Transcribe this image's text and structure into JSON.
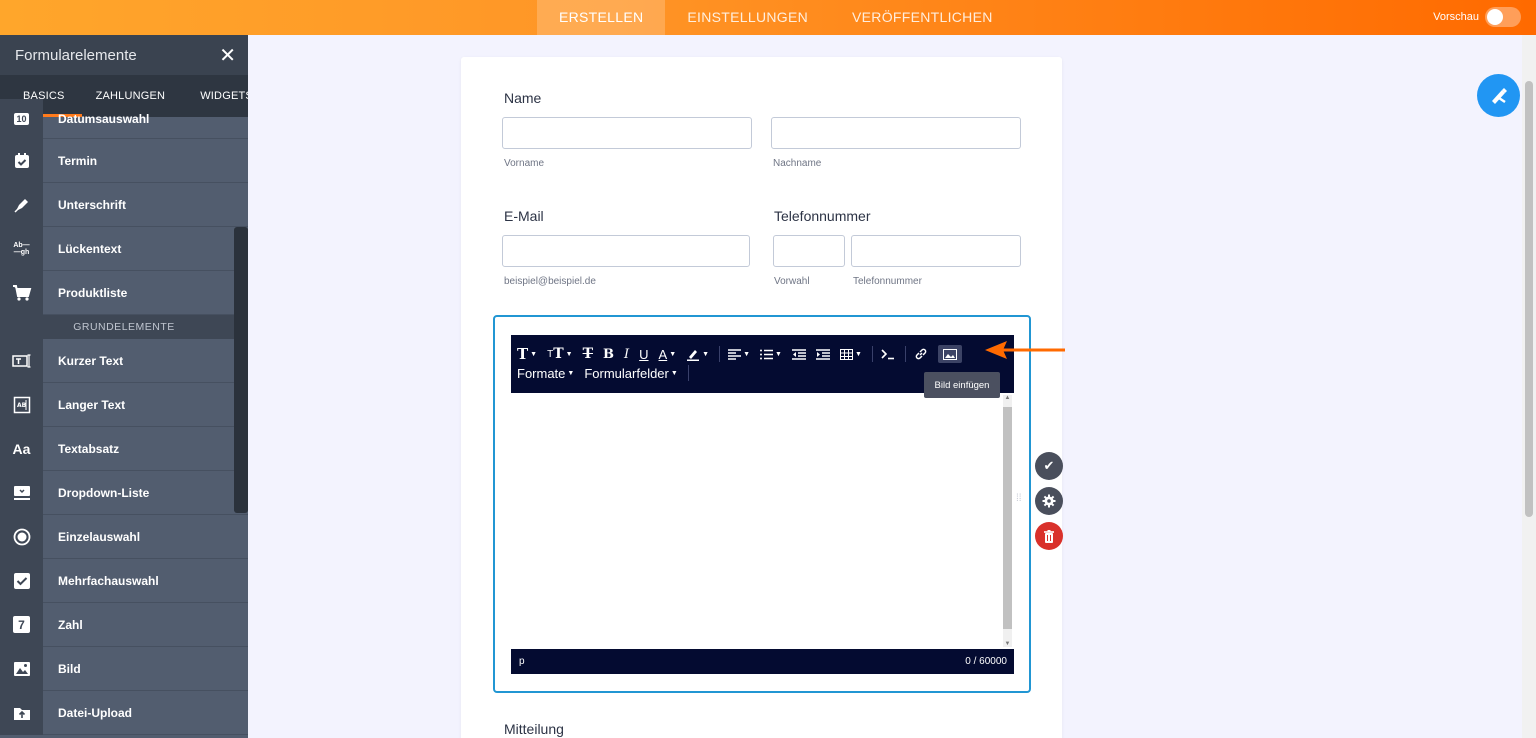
{
  "topbar": {
    "tabs": [
      {
        "label": "ERSTELLEN",
        "active": true
      },
      {
        "label": "EINSTELLUNGEN",
        "active": false
      },
      {
        "label": "VERÖFFENTLICHEN",
        "active": false
      }
    ],
    "preview_label": "Vorschau"
  },
  "sidebar": {
    "title": "Formularelemente",
    "tabs": [
      "BASICS",
      "ZAHLUNGEN",
      "WIDGETS"
    ],
    "items_top": [
      {
        "label": "Datumsauswahl",
        "icon": "calendar-10-icon"
      },
      {
        "label": "Termin",
        "icon": "calendar-check-icon"
      },
      {
        "label": "Unterschrift",
        "icon": "pen-icon"
      },
      {
        "label": "Lückentext",
        "icon": "fill-in-text-icon"
      },
      {
        "label": "Produktliste",
        "icon": "cart-icon"
      }
    ],
    "section_label": "GRUNDELEMENTE",
    "items_bottom": [
      {
        "label": "Kurzer Text",
        "icon": "short-text-icon"
      },
      {
        "label": "Langer Text",
        "icon": "long-text-icon"
      },
      {
        "label": "Textabsatz",
        "icon": "paragraph-icon"
      },
      {
        "label": "Dropdown-Liste",
        "icon": "dropdown-icon"
      },
      {
        "label": "Einzelauswahl",
        "icon": "radio-icon"
      },
      {
        "label": "Mehrfachauswahl",
        "icon": "checkbox-icon"
      },
      {
        "label": "Zahl",
        "icon": "number-icon"
      },
      {
        "label": "Bild",
        "icon": "image-icon"
      },
      {
        "label": "Datei-Upload",
        "icon": "upload-icon"
      }
    ],
    "icon_glyphs": {
      "sb10": "10",
      "aa": "Aa",
      "seven": "7",
      "abgh": "Ab—\n—gh"
    }
  },
  "form": {
    "name_label": "Name",
    "first_name_sub": "Vorname",
    "last_name_sub": "Nachname",
    "email_label": "E-Mail",
    "email_sub": "beispiel@beispiel.de",
    "phone_label": "Telefonnummer",
    "area_code_sub": "Vorwahl",
    "phone_sub": "Telefonnummer",
    "message_label": "Mitteilung",
    "editor": {
      "formats_label": "Formate",
      "fields_label": "Formularfelder",
      "tooltip": "Bild einfügen",
      "status_tag": "p",
      "char_count": "0 / 60000"
    }
  },
  "colors": {
    "accent_orange": "#ff6a00",
    "editor_dark": "#040b31",
    "selection_blue": "#2196d3",
    "delete_red": "#d9312b"
  }
}
